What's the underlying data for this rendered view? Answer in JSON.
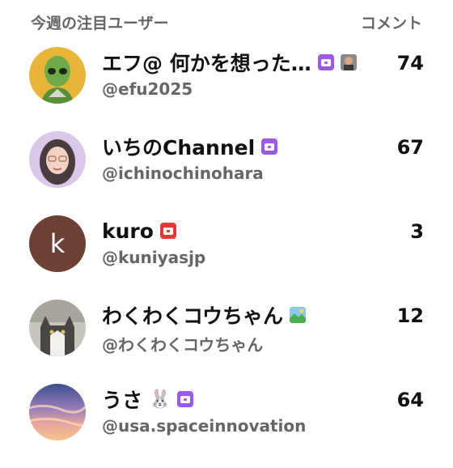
{
  "header": {
    "title": "今週の注目ユーザー",
    "comments_label": "コメント"
  },
  "users": [
    {
      "name": "エフ@ 何かを想った…",
      "handle": "@efu2025",
      "comments": "74",
      "badge": "purple",
      "avatar_icon": "alien-icon"
    },
    {
      "name": "いちのChannel",
      "handle": "@ichinochinohara",
      "comments": "67",
      "badge": "purple",
      "avatar_icon": "person-photo"
    },
    {
      "name": "kuro",
      "handle": "@kuniyasjp",
      "comments": "3",
      "badge": "red",
      "avatar_letter": "k"
    },
    {
      "name": "わくわくコウちゃん",
      "handle": "@わくわくコウちゃん",
      "comments": "12",
      "badge": "none",
      "avatar_icon": "cat-photo"
    },
    {
      "name": "うさ",
      "emoji": "🐰",
      "handle": "@usa.spaceinnovation",
      "comments": "64",
      "badge": "purple",
      "avatar_icon": "sunset-photo"
    }
  ],
  "colors": {
    "badge_purple": "#9b59e8",
    "badge_red": "#e53935",
    "avatar_k_bg": "#6d4036"
  }
}
